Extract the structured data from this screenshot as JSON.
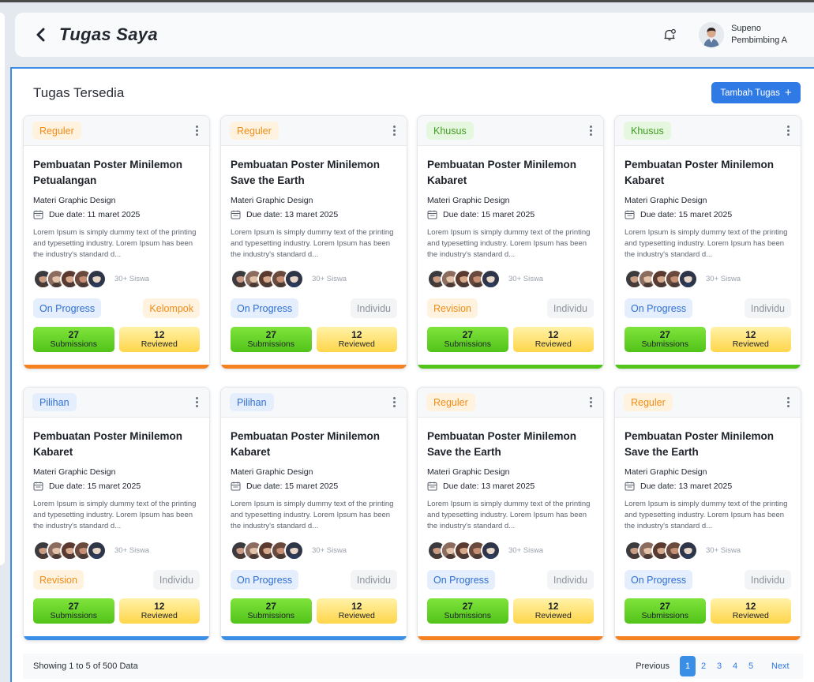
{
  "header": {
    "title": "Tugas Saya",
    "user_name": "Supeno",
    "user_role": "Pembimbing A"
  },
  "section": {
    "title": "Tugas Tersedia",
    "add_button": "Tambah Tugas"
  },
  "colors": {
    "accent": "#2f7ae5",
    "reguler_bg": "#fff3df",
    "reguler_text": "#f08c1a",
    "khusus_bg": "#e6f7df",
    "khusus_text": "#3f9c22",
    "pilihan_bg": "#e4eefc",
    "pilihan_text": "#2f6fd4",
    "bar_orange": "#f58220",
    "bar_green": "#52c41a",
    "bar_blue": "#3a8ee6"
  },
  "cards": [
    {
      "type": "Reguler",
      "title": "Pembuatan Poster Minilemon Petualangan",
      "subject": "Materi Graphic Design",
      "due": "Due date: 11 maret 2025",
      "desc": "Lorem Ipsum is simply dummy text of the printing and typesetting industry. Lorem Ipsum has been the industry's standard d...",
      "siswa": "30+ Siswa",
      "status": "On Progress",
      "mode": "Kelompok",
      "submissions_count": "27",
      "submissions_label": "Submissions",
      "reviewed_count": "12",
      "reviewed_label": "Reviewed"
    },
    {
      "type": "Reguler",
      "title": "Pembuatan Poster Minilemon Save the Earth",
      "subject": "Materi Graphic Design",
      "due": "Due date: 13 maret 2025",
      "desc": "Lorem Ipsum is simply dummy text of the printing and typesetting industry. Lorem Ipsum has been the industry's standard d...",
      "siswa": "30+ Siswa",
      "status": "On Progress",
      "mode": "Individu",
      "submissions_count": "27",
      "submissions_label": "Submissions",
      "reviewed_count": "12",
      "reviewed_label": "Reviewed"
    },
    {
      "type": "Khusus",
      "title": "Pembuatan Poster Minilemon Kabaret",
      "subject": "Materi Graphic Design",
      "due": "Due date: 15 maret 2025",
      "desc": "Lorem Ipsum is simply dummy text of the printing and typesetting industry. Lorem Ipsum has been the industry's standard d...",
      "siswa": "30+ Siswa",
      "status": "Revision",
      "mode": "Individu",
      "submissions_count": "27",
      "submissions_label": "Submissions",
      "reviewed_count": "12",
      "reviewed_label": "Reviewed"
    },
    {
      "type": "Khusus",
      "title": "Pembuatan Poster Minilemon Kabaret",
      "subject": "Materi Graphic Design",
      "due": "Due date: 15 maret 2025",
      "desc": "Lorem Ipsum is simply dummy text of the printing and typesetting industry. Lorem Ipsum has been the industry's standard d...",
      "siswa": "30+ Siswa",
      "status": "On Progress",
      "mode": "Individu",
      "submissions_count": "27",
      "submissions_label": "Submissions",
      "reviewed_count": "12",
      "reviewed_label": "Reviewed"
    },
    {
      "type": "Pilihan",
      "title": "Pembuatan Poster Minilemon Kabaret",
      "subject": "Materi Graphic Design",
      "due": "Due date: 15 maret 2025",
      "desc": "Lorem Ipsum is simply dummy text of the printing and typesetting industry. Lorem Ipsum has been the industry's standard d...",
      "siswa": "30+ Siswa",
      "status": "Revision",
      "mode": "Individu",
      "submissions_count": "27",
      "submissions_label": "Submissions",
      "reviewed_count": "12",
      "reviewed_label": "Reviewed"
    },
    {
      "type": "Pilihan",
      "title": "Pembuatan Poster Minilemon Kabaret",
      "subject": "Materi Graphic Design",
      "due": "Due date: 15 maret 2025",
      "desc": "Lorem Ipsum is simply dummy text of the printing and typesetting industry. Lorem Ipsum has been the industry's standard d...",
      "siswa": "30+ Siswa",
      "status": "On Progress",
      "mode": "Individu",
      "submissions_count": "27",
      "submissions_label": "Submissions",
      "reviewed_count": "12",
      "reviewed_label": "Reviewed"
    },
    {
      "type": "Reguler",
      "title": "Pembuatan Poster Minilemon Save the Earth",
      "subject": "Materi Graphic Design",
      "due": "Due date: 13 maret 2025",
      "desc": "Lorem Ipsum is simply dummy text of the printing and typesetting industry. Lorem Ipsum has been the industry's standard d...",
      "siswa": "30+ Siswa",
      "status": "On Progress",
      "mode": "Individu",
      "submissions_count": "27",
      "submissions_label": "Submissions",
      "reviewed_count": "12",
      "reviewed_label": "Reviewed"
    },
    {
      "type": "Reguler",
      "title": "Pembuatan Poster Minilemon Save the Earth",
      "subject": "Materi Graphic Design",
      "due": "Due date: 13 maret 2025",
      "desc": "Lorem Ipsum is simply dummy text of the printing and typesetting industry. Lorem Ipsum has been the industry's standard d...",
      "siswa": "30+ Siswa",
      "status": "On Progress",
      "mode": "Individu",
      "submissions_count": "27",
      "submissions_label": "Submissions",
      "reviewed_count": "12",
      "reviewed_label": "Reviewed"
    }
  ],
  "footer": {
    "showing": "Showing 1 to 5 of 500 Data",
    "previous": "Previous",
    "next": "Next",
    "pages": [
      "1",
      "2",
      "3",
      "4",
      "5"
    ],
    "current_page": "1"
  }
}
